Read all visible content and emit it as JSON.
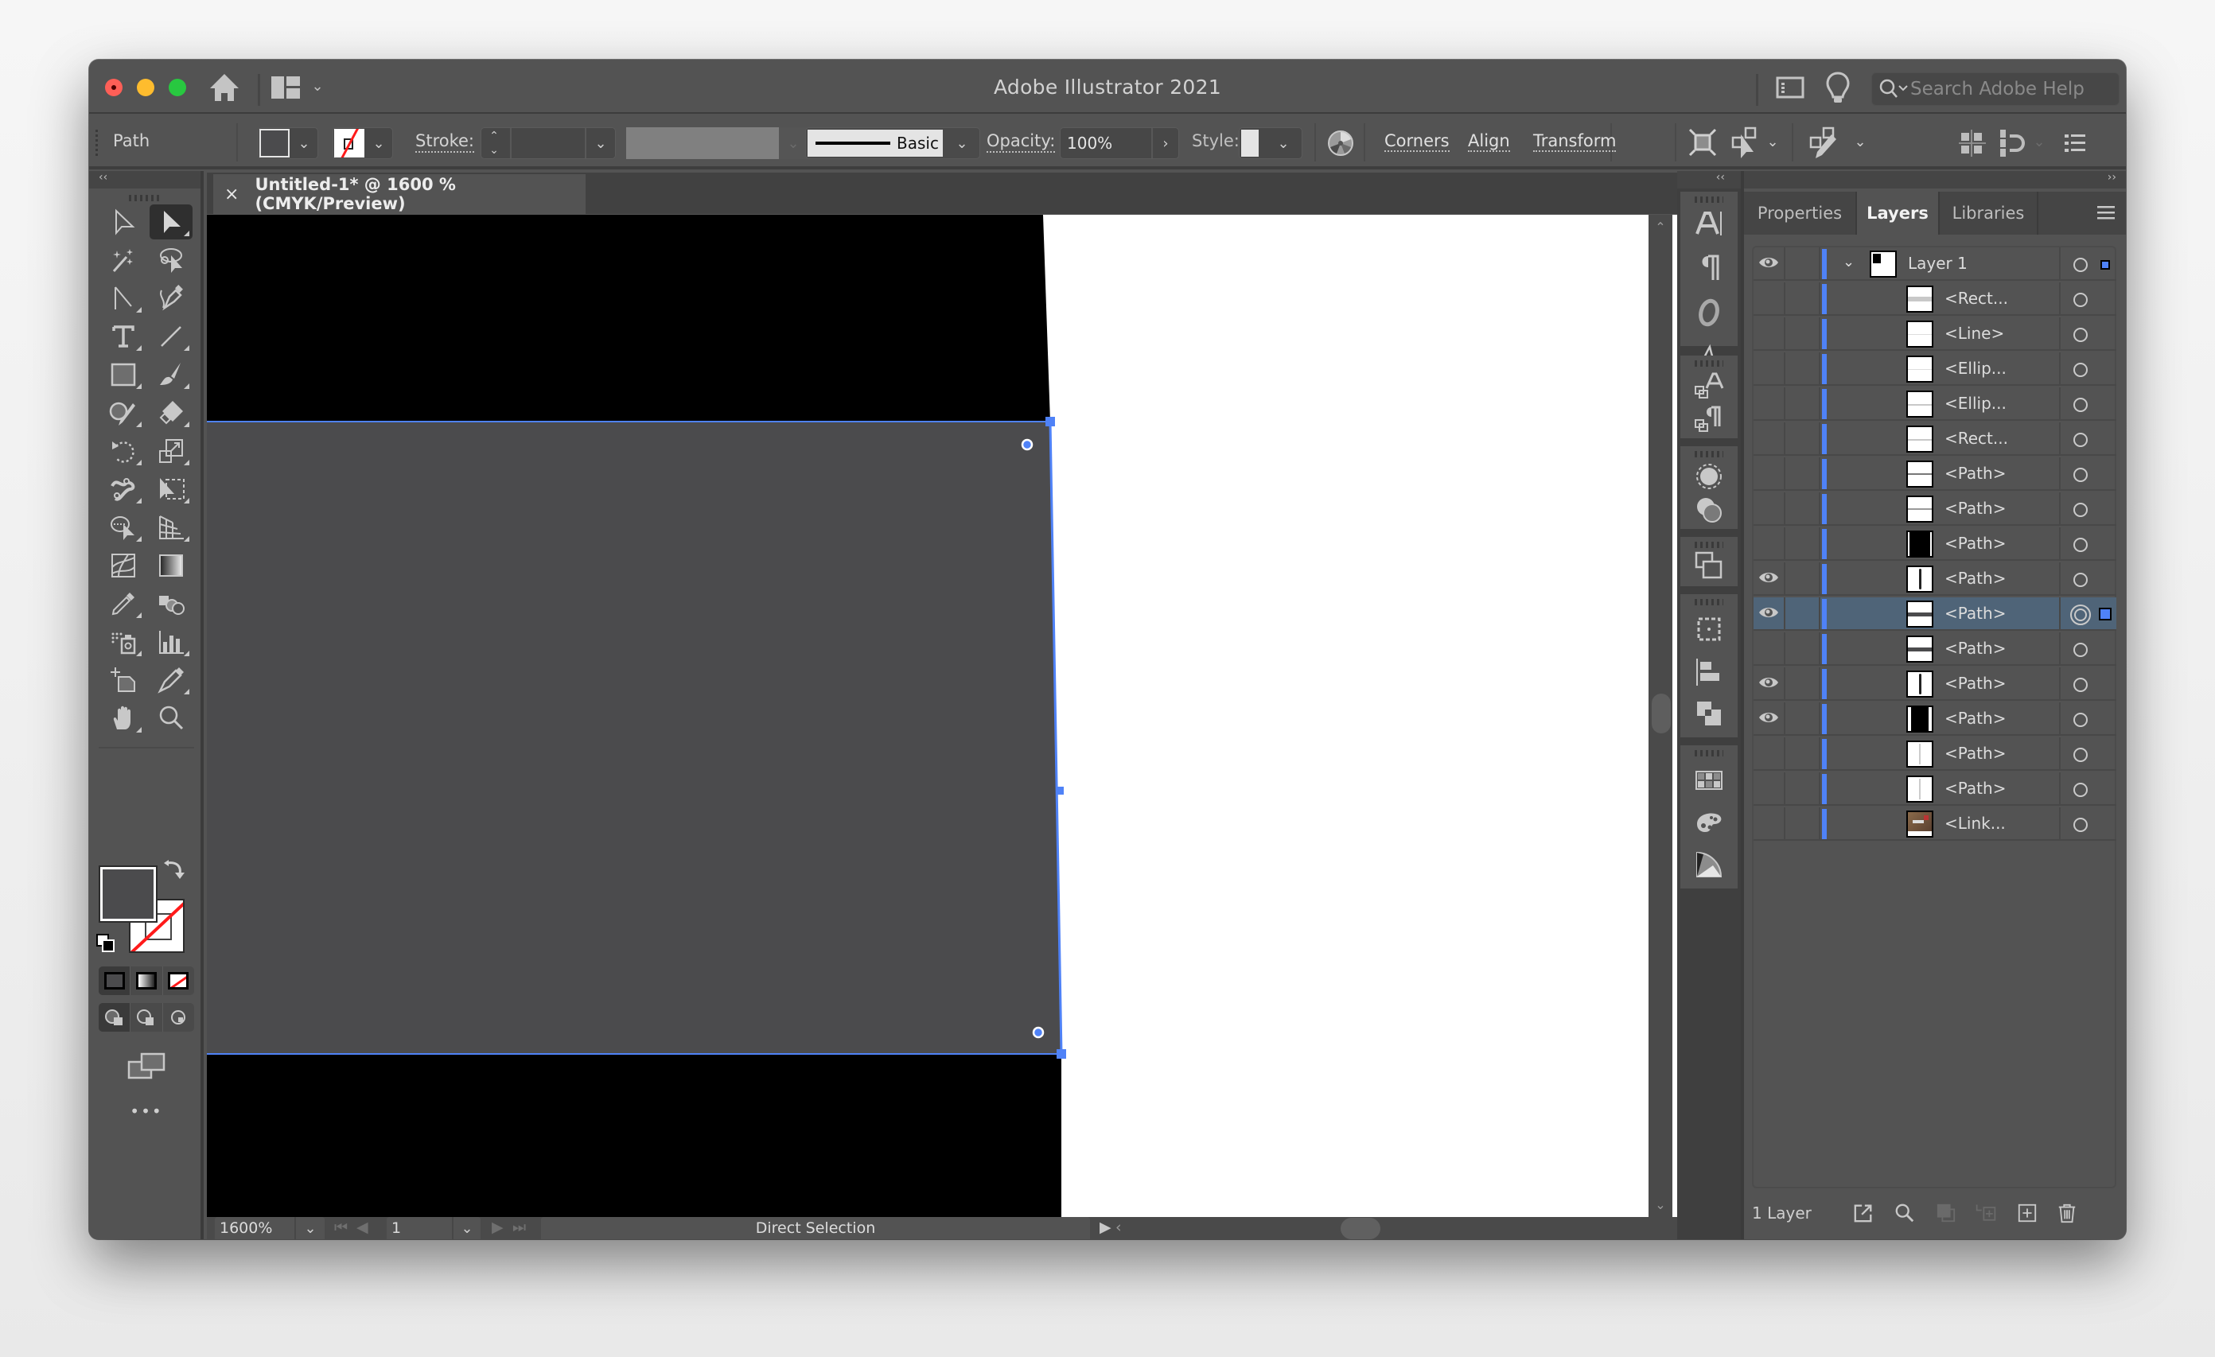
{
  "app": {
    "title": "Adobe Illustrator 2021",
    "search_placeholder": "Search Adobe Help"
  },
  "control_bar": {
    "selection_type": "Path",
    "fill_color": "#4b4b4d",
    "stroke_label": "Stroke:",
    "stroke_weight": "",
    "brush_label": "Basic",
    "opacity_label": "Opacity:",
    "opacity_value": "100%",
    "style_label": "Style:",
    "links": [
      "Corners",
      "Align",
      "Transform"
    ]
  },
  "document": {
    "tab_title": "Untitled-1* @ 1600 % (CMYK/Preview)",
    "close_glyph": "×"
  },
  "status_bar": {
    "zoom": "1600%",
    "artboard": "1",
    "current_tool": "Direct Selection"
  },
  "tools": {
    "active": "Direct Selection",
    "items": [
      "selection-tool",
      "direct-selection-tool",
      "magic-wand-tool",
      "lasso-tool",
      "anchor-point-tool",
      "pen-tool",
      "type-tool",
      "line-segment-tool",
      "rectangle-tool",
      "paintbrush-tool",
      "shaper-tool",
      "eraser-tool",
      "rotate-tool",
      "scale-tool",
      "puppet-warp-tool",
      "free-transform-tool",
      "shape-builder-tool",
      "perspective-grid-tool",
      "mesh-tool",
      "gradient-tool",
      "eyedropper-tool",
      "blend-tool",
      "symbol-sprayer-tool",
      "column-graph-tool",
      "artboard-tool",
      "slice-tool",
      "hand-tool",
      "zoom-tool"
    ],
    "more_glyph": "•••"
  },
  "right_panel": {
    "tabs": [
      "Properties",
      "Layers",
      "Libraries"
    ],
    "active_tab": "Layers",
    "layer_count": "1 Layer",
    "accent_color": "#4f82f7",
    "layers": [
      {
        "name": "Layer 1",
        "visible": true,
        "top": true,
        "thumb": "layer"
      },
      {
        "name": "<Rect...",
        "visible": false,
        "thumb": "hband-light"
      },
      {
        "name": "<Line>",
        "visible": false,
        "thumb": "hline-faint"
      },
      {
        "name": "<Ellip...",
        "visible": false,
        "thumb": "hline-faint"
      },
      {
        "name": "<Ellip...",
        "visible": false,
        "thumb": "hline-light"
      },
      {
        "name": "<Rect...",
        "visible": false,
        "thumb": "hline-light"
      },
      {
        "name": "<Path>",
        "visible": false,
        "thumb": "hline-dark"
      },
      {
        "name": "<Path>",
        "visible": false,
        "thumb": "hline-mid"
      },
      {
        "name": "<Path>",
        "visible": false,
        "thumb": "black-block"
      },
      {
        "name": "<Path>",
        "visible": true,
        "thumb": "vline-dark"
      },
      {
        "name": "<Path>",
        "visible": true,
        "thumb": "hband-dark",
        "selected": true
      },
      {
        "name": "<Path>",
        "visible": false,
        "thumb": "hband-dark"
      },
      {
        "name": "<Path>",
        "visible": true,
        "thumb": "vline-dark"
      },
      {
        "name": "<Path>",
        "visible": true,
        "thumb": "black-wide"
      },
      {
        "name": "<Path>",
        "visible": false,
        "thumb": "vline-light"
      },
      {
        "name": "<Path>",
        "visible": false,
        "thumb": "vline-light"
      },
      {
        "name": "<Link...",
        "visible": false,
        "thumb": "photo"
      }
    ]
  },
  "canvas": {
    "artboard_color": "#ffffff",
    "shape_fill": "#4b4b4d",
    "selection_color": "#4f82f7"
  }
}
